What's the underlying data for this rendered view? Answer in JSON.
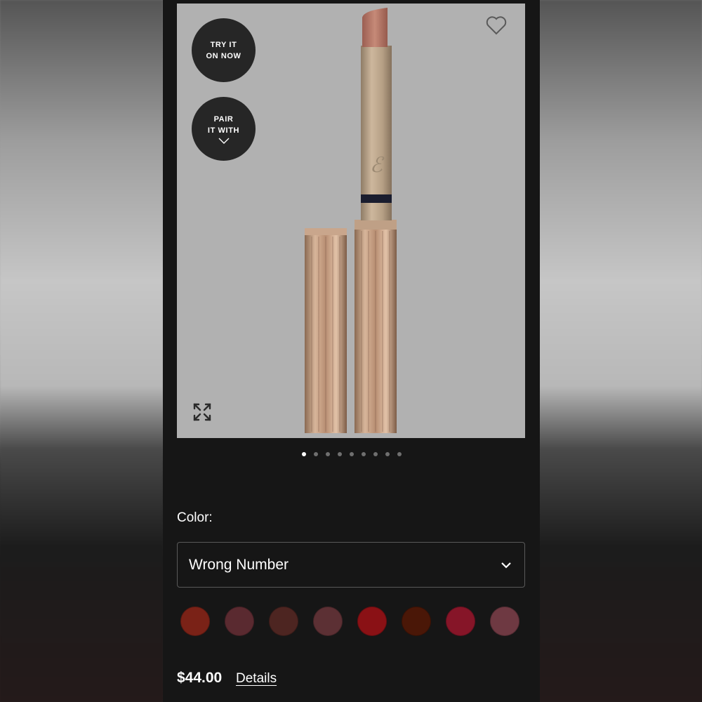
{
  "product_image": {
    "try_on_label_line1": "TRY IT",
    "try_on_label_line2": "ON NOW",
    "pair_label_line1": "PAIR",
    "pair_label_line2": "IT WITH",
    "carousel_total": 9,
    "carousel_active_index": 0
  },
  "color": {
    "label": "Color:",
    "selected": "Wrong Number",
    "swatches": [
      "#7a2217",
      "#5a2a30",
      "#4d2521",
      "#5c3034",
      "#8a1115",
      "#4a1707",
      "#861528",
      "#6e3942"
    ]
  },
  "pricing": {
    "price": "$44.00",
    "details_link": "Details"
  }
}
